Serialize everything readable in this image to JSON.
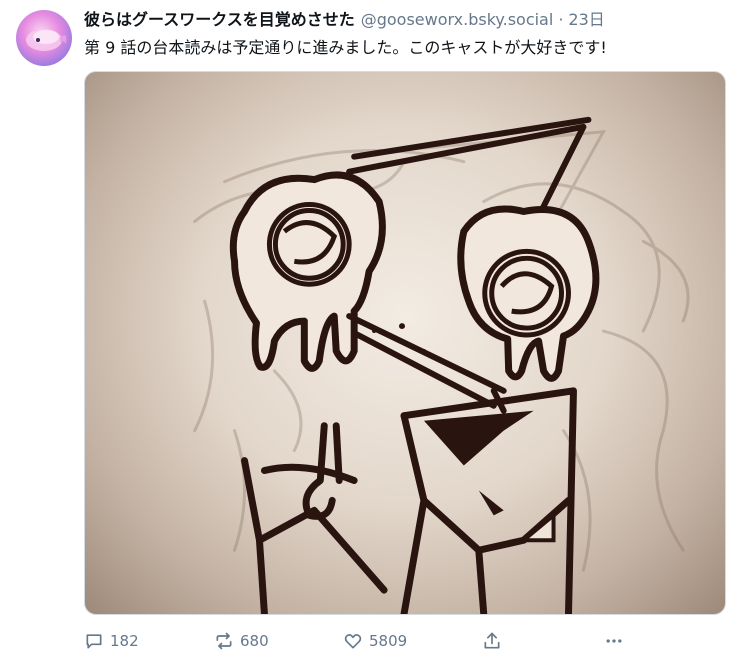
{
  "post": {
    "author": {
      "display_name": "彼らはグースワークスを目覚めさせた",
      "handle": "@gooseworx.bsky.social",
      "avatar_icon": "pink-whale-avatar"
    },
    "separator": "·",
    "timestamp": "23日",
    "text": "第 9 話の台本読みは予定通りに進みました。このキャストが大好きです!",
    "media": {
      "image_icon": "sketch-character-image"
    },
    "actions": {
      "reply_count": "182",
      "repost_count": "680",
      "like_count": "5809"
    }
  },
  "colors": {
    "text_primary": "#0f1419",
    "text_secondary": "#66788a",
    "sketch_ink": "#2a1410",
    "sketch_background": "#e3d7cb"
  }
}
